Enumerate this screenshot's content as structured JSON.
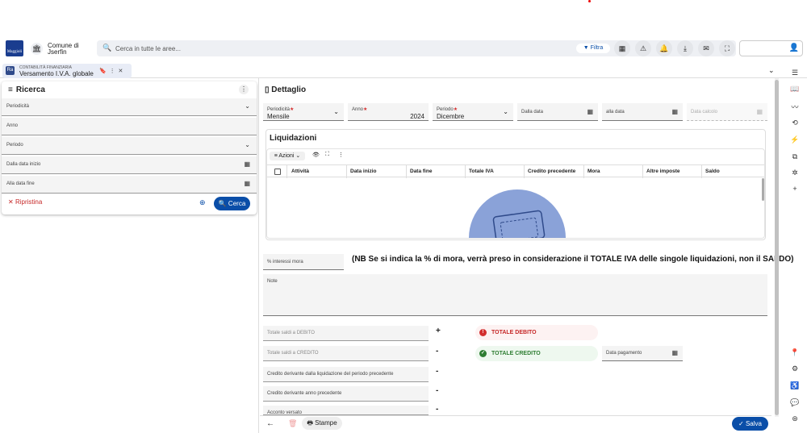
{
  "app": {
    "municipality": "Comune di Jserfin",
    "logo_text": "Maggioli"
  },
  "search": {
    "placeholder": "Cerca in tutte le aree...",
    "filter_label": "Filtra"
  },
  "tab": {
    "module": "CONTABILITÀ FINANZIARIA",
    "title": "Versamento I.V.A. globale",
    "icon_text": "Ra"
  },
  "left_panel": {
    "title": "Ricerca",
    "fields": [
      {
        "label": "Periodicità"
      },
      {
        "label": "Anno"
      },
      {
        "label": "Periodo"
      },
      {
        "label": "Dalla data inizio"
      },
      {
        "label": "Alla data fine"
      }
    ],
    "reset_label": "Ripristina",
    "search_label": "Cerca"
  },
  "detail": {
    "title": "Dettaglio",
    "periodicita": {
      "label": "Periodicità",
      "value": "Mensile"
    },
    "anno": {
      "label": "Anno",
      "value": "2024"
    },
    "periodo": {
      "label": "Periodo",
      "value": "Dicembre"
    },
    "dalla_data": {
      "label": "Dalla data"
    },
    "alla_data": {
      "label": "alla data"
    },
    "data_calcolo": {
      "label": "Data calcolo"
    },
    "liquidazioni": {
      "title": "Liquidazioni",
      "actions_label": "Azioni",
      "columns": [
        "Attività",
        "Data inizio",
        "Data fine",
        "Totale IVA",
        "Credito precedente",
        "Mora",
        "Altre imposte",
        "Saldo"
      ]
    },
    "interessi_mora": {
      "label": "% interessi mora"
    },
    "nb_text": "(NB Se si indica la % di mora, verrà preso in considerazione il TOTALE IVA delle singole liquidazioni, non il SALDO)",
    "note": {
      "label": "Note"
    },
    "totale_saldi_debito": {
      "label": "Totale saldi a DEBITO",
      "sign": "+"
    },
    "totale_saldi_credito": {
      "label": "Totale saldi a CREDITO",
      "sign": "-"
    },
    "credito_liquidazione": {
      "label": "Credito derivante dalla liquidazione del periodo precedente",
      "sign": "-"
    },
    "credito_anno": {
      "label": "Credito derivante anno precedente",
      "sign": "-"
    },
    "acconto": {
      "label": "Acconto versato",
      "sign": "-"
    },
    "totale_debito": "TOTALE DEBITO",
    "totale_credito": "TOTALE CREDITO",
    "data_pagamento": {
      "label": "Data pagamento"
    }
  },
  "footer": {
    "stampe_label": "Stampe",
    "salva_label": "Salva"
  },
  "colors": {
    "primary": "#0a4ea8",
    "danger": "#d32f2f",
    "success": "#2e7d32"
  }
}
